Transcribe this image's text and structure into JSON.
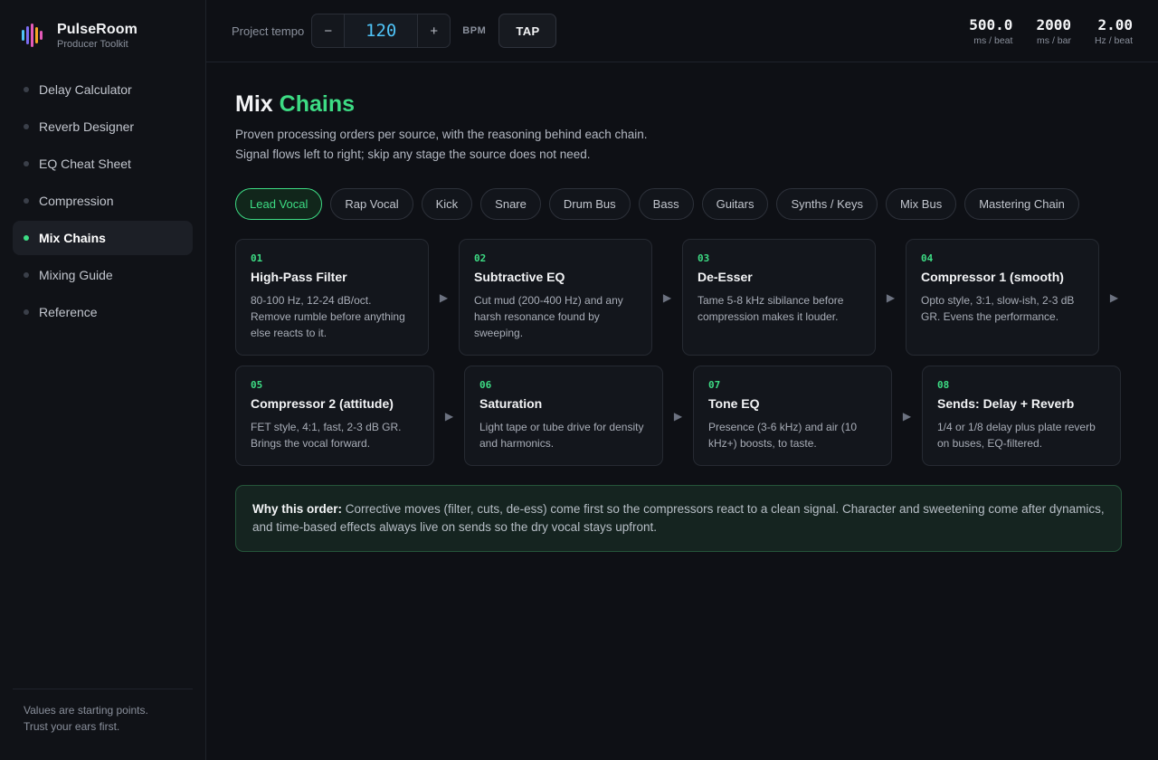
{
  "brand": {
    "name": "PulseRoom",
    "subtitle": "Producer Toolkit",
    "logo_colors": [
      "#4fc3f7",
      "#7c6cf2",
      "#e45ab8",
      "#f5a623"
    ]
  },
  "sidebar": {
    "items": [
      {
        "label": "Delay Calculator"
      },
      {
        "label": "Reverb Designer"
      },
      {
        "label": "EQ Cheat Sheet"
      },
      {
        "label": "Compression"
      },
      {
        "label": "Mix Chains",
        "active": true
      },
      {
        "label": "Mixing Guide"
      },
      {
        "label": "Reference"
      }
    ],
    "footer": {
      "line1": "Values are starting points.",
      "line2": "Trust your ears first."
    }
  },
  "topbar": {
    "tempo_label": "Project tempo",
    "decrement": "−",
    "tempo_value": "120",
    "increment": "+",
    "bpm_label": "BPM",
    "tap_label": "TAP",
    "stats": [
      {
        "value": "500.0",
        "unit": "ms / beat"
      },
      {
        "value": "2000",
        "unit": "ms / bar"
      },
      {
        "value": "2.00",
        "unit": "Hz / beat"
      }
    ]
  },
  "page": {
    "title_main": "Mix",
    "title_accent": "Chains",
    "desc_line1": "Proven processing orders per source, with the reasoning behind each chain.",
    "desc_line2": "Signal flows left to right; skip any stage the source does not need."
  },
  "tabs": [
    {
      "label": "Lead Vocal",
      "active": true
    },
    {
      "label": "Rap Vocal"
    },
    {
      "label": "Kick"
    },
    {
      "label": "Snare"
    },
    {
      "label": "Drum Bus"
    },
    {
      "label": "Bass"
    },
    {
      "label": "Guitars"
    },
    {
      "label": "Synths / Keys"
    },
    {
      "label": "Mix Bus"
    },
    {
      "label": "Mastering Chain"
    }
  ],
  "chain": [
    {
      "num": "01",
      "title": "High-Pass Filter",
      "body": "80-100 Hz, 12-24 dB/oct. Remove rumble before anything else reacts to it."
    },
    {
      "num": "02",
      "title": "Subtractive EQ",
      "body": "Cut mud (200-400 Hz) and any harsh resonance found by sweeping."
    },
    {
      "num": "03",
      "title": "De-Esser",
      "body": "Tame 5-8 kHz sibilance before compression makes it louder."
    },
    {
      "num": "04",
      "title": "Compressor 1 (smooth)",
      "body": "Opto style, 3:1, slow-ish, 2-3 dB GR. Evens the performance."
    },
    {
      "num": "05",
      "title": "Compressor 2 (attitude)",
      "body": "FET style, 4:1, fast, 2-3 dB GR. Brings the vocal forward."
    },
    {
      "num": "06",
      "title": "Saturation",
      "body": "Light tape or tube drive for density and harmonics."
    },
    {
      "num": "07",
      "title": "Tone EQ",
      "body": "Presence (3-6 kHz) and air (10 kHz+) boosts, to taste."
    },
    {
      "num": "08",
      "title": "Sends: Delay + Reverb",
      "body": "1/4 or 1/8 delay plus plate reverb on buses, EQ-filtered."
    }
  ],
  "why": {
    "lead": "Why this order:",
    "text": "Corrective moves (filter, cuts, de-ess) come first so the compressors react to a clean signal. Character and sweetening come after dynamics, and time-based effects always live on sends so the dry vocal stays upfront."
  },
  "colors": {
    "accent": "#3ddc84",
    "tempo": "#4fc3f7",
    "background": "#0e1015"
  }
}
